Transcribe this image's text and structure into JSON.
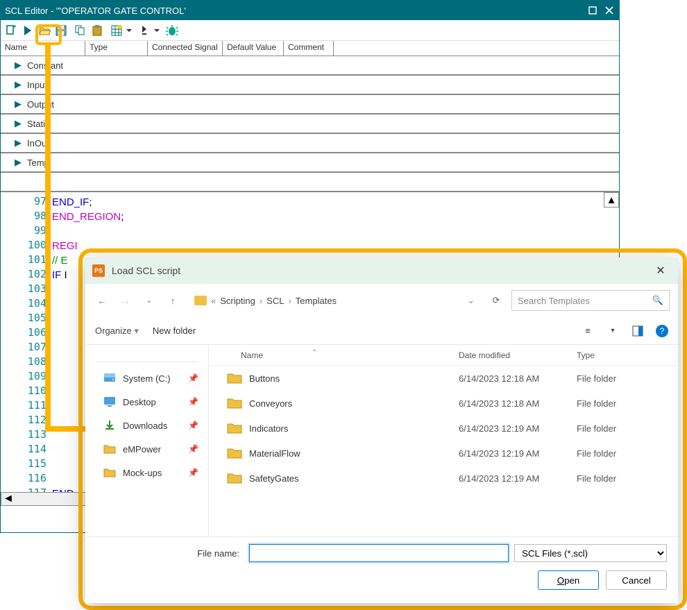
{
  "window": {
    "title": "SCL Editor  -  '''OPERATOR GATE CONTROL'"
  },
  "table": {
    "cols": {
      "name": "Name",
      "type": "Type",
      "sig": "Connected Signal",
      "def": "Default Value",
      "com": "Comment"
    },
    "groups": [
      "Constant",
      "Input",
      "Output",
      "Static",
      "InOut",
      "Temp"
    ]
  },
  "code": {
    "start": 97,
    "lines": [
      {
        "n": 97,
        "html": "<span class='end'>END_IF</span>;"
      },
      {
        "n": 98,
        "html": "<span class='region'>END_REGION</span>;"
      },
      {
        "n": 99,
        "html": ""
      },
      {
        "n": 100,
        "html": "<span class='region'>REGI</span>"
      },
      {
        "n": 101,
        "html": "<span class='comment'>// E</span>"
      },
      {
        "n": 102,
        "html": "<span class='kw'>IF</span> I"
      },
      {
        "n": 103,
        "html": ""
      },
      {
        "n": 104,
        "html": ""
      },
      {
        "n": 105,
        "html": ""
      },
      {
        "n": 106,
        "html": ""
      },
      {
        "n": 107,
        "html": ""
      },
      {
        "n": 108,
        "html": ""
      },
      {
        "n": 109,
        "html": ""
      },
      {
        "n": 110,
        "html": ""
      },
      {
        "n": 111,
        "html": ""
      },
      {
        "n": 112,
        "html": ""
      },
      {
        "n": 113,
        "html": ""
      },
      {
        "n": 114,
        "html": ""
      },
      {
        "n": 115,
        "html": ""
      },
      {
        "n": 116,
        "html": ""
      },
      {
        "n": 117,
        "html": "<span class='end'>END_</span>"
      }
    ]
  },
  "dialog": {
    "title": "Load SCL script",
    "breadcrumb": [
      "Scripting",
      "SCL",
      "Templates"
    ],
    "search_placeholder": "Search Templates",
    "organize": "Organize",
    "newfolder": "New folder",
    "fn_label": "File name:",
    "filter": "SCL Files (*.scl)",
    "open": "Open",
    "cancel": "Cancel",
    "side": [
      {
        "label": "System (C:)",
        "icon": "drive"
      },
      {
        "label": "Desktop",
        "icon": "desktop"
      },
      {
        "label": "Downloads",
        "icon": "download"
      },
      {
        "label": "eMPower",
        "icon": "folder"
      },
      {
        "label": "Mock-ups",
        "icon": "folder"
      }
    ],
    "cols": {
      "name": "Name",
      "date": "Date modified",
      "type": "Type"
    },
    "files": [
      {
        "name": "Buttons",
        "date": "6/14/2023 12:18 AM",
        "type": "File folder"
      },
      {
        "name": "Conveyors",
        "date": "6/14/2023 12:18 AM",
        "type": "File folder"
      },
      {
        "name": "Indicators",
        "date": "6/14/2023 12:19 AM",
        "type": "File folder"
      },
      {
        "name": "MaterialFlow",
        "date": "6/14/2023 12:19 AM",
        "type": "File folder"
      },
      {
        "name": "SafetyGates",
        "date": "6/14/2023 12:19 AM",
        "type": "File folder"
      }
    ]
  }
}
